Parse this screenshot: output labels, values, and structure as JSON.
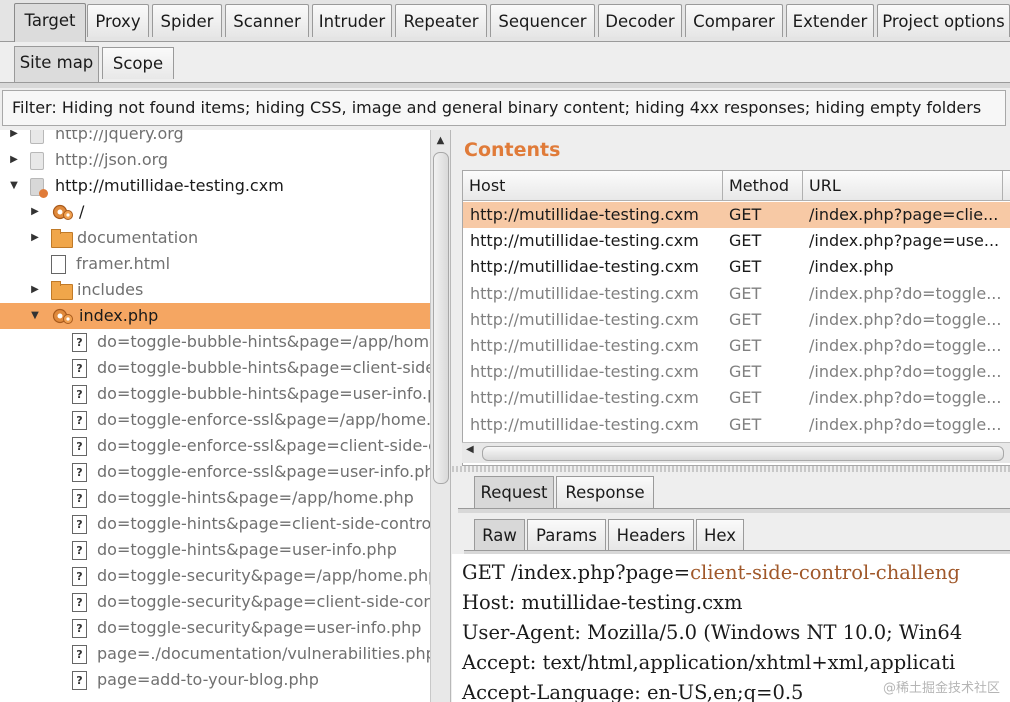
{
  "top_tabs": [
    "Target",
    "Proxy",
    "Spider",
    "Scanner",
    "Intruder",
    "Repeater",
    "Sequencer",
    "Decoder",
    "Comparer",
    "Extender",
    "Project options"
  ],
  "sub_tabs": [
    "Site map",
    "Scope"
  ],
  "filter": "Filter: Hiding not found items;  hiding CSS, image and general binary content;  hiding 4xx responses;  hiding empty folders",
  "tree": [
    {
      "label": "http://jquery.org",
      "type": "host",
      "expand": "collapsed",
      "indent": 0,
      "style": "gray"
    },
    {
      "label": "http://json.org",
      "type": "host",
      "expand": "collapsed",
      "indent": 0,
      "style": "gray"
    },
    {
      "label": "http://mutillidae-testing.cxm",
      "type": "host-active",
      "expand": "expanded",
      "indent": 0,
      "style": "dark"
    },
    {
      "label": "/",
      "type": "gear",
      "expand": "collapsed",
      "indent": 1,
      "style": "dark"
    },
    {
      "label": "documentation",
      "type": "folder",
      "expand": "collapsed",
      "indent": 1,
      "style": "gray"
    },
    {
      "label": "framer.html",
      "type": "file",
      "expand": "none",
      "indent": 1,
      "style": "gray"
    },
    {
      "label": "includes",
      "type": "folder",
      "expand": "collapsed",
      "indent": 1,
      "style": "gray"
    },
    {
      "label": "index.php",
      "type": "gear",
      "expand": "expanded",
      "indent": 1,
      "style": "dark",
      "selected": true
    },
    {
      "label": "do=toggle-bubble-hints&page=/app/home.",
      "type": "q",
      "expand": "none",
      "indent": 2,
      "style": "gray"
    },
    {
      "label": "do=toggle-bubble-hints&page=client-side-",
      "type": "q",
      "expand": "none",
      "indent": 2,
      "style": "gray"
    },
    {
      "label": "do=toggle-bubble-hints&page=user-info.pl",
      "type": "q",
      "expand": "none",
      "indent": 2,
      "style": "gray"
    },
    {
      "label": "do=toggle-enforce-ssl&page=/app/home.p",
      "type": "q",
      "expand": "none",
      "indent": 2,
      "style": "gray"
    },
    {
      "label": "do=toggle-enforce-ssl&page=client-side-co",
      "type": "q",
      "expand": "none",
      "indent": 2,
      "style": "gray"
    },
    {
      "label": "do=toggle-enforce-ssl&page=user-info.php",
      "type": "q",
      "expand": "none",
      "indent": 2,
      "style": "gray"
    },
    {
      "label": "do=toggle-hints&page=/app/home.php",
      "type": "q",
      "expand": "none",
      "indent": 2,
      "style": "gray"
    },
    {
      "label": "do=toggle-hints&page=client-side-control-",
      "type": "q",
      "expand": "none",
      "indent": 2,
      "style": "gray"
    },
    {
      "label": "do=toggle-hints&page=user-info.php",
      "type": "q",
      "expand": "none",
      "indent": 2,
      "style": "gray"
    },
    {
      "label": "do=toggle-security&page=/app/home.php",
      "type": "q",
      "expand": "none",
      "indent": 2,
      "style": "gray"
    },
    {
      "label": "do=toggle-security&page=client-side-contr",
      "type": "q",
      "expand": "none",
      "indent": 2,
      "style": "gray"
    },
    {
      "label": "do=toggle-security&page=user-info.php",
      "type": "q",
      "expand": "none",
      "indent": 2,
      "style": "gray"
    },
    {
      "label": "page=./documentation/vulnerabilities.php",
      "type": "q",
      "expand": "none",
      "indent": 2,
      "style": "gray"
    },
    {
      "label": "page=add-to-your-blog.php",
      "type": "q",
      "expand": "none",
      "indent": 2,
      "style": "gray"
    }
  ],
  "contents": {
    "title": "Contents",
    "columns": [
      "Host",
      "Method",
      "URL"
    ],
    "rows": [
      {
        "host": "http://mutillidae-testing.cxm",
        "method": "GET",
        "url": "/index.php?page=clie...",
        "selected": true,
        "dim": false
      },
      {
        "host": "http://mutillidae-testing.cxm",
        "method": "GET",
        "url": "/index.php?page=use...",
        "selected": false,
        "dim": false
      },
      {
        "host": "http://mutillidae-testing.cxm",
        "method": "GET",
        "url": "/index.php",
        "selected": false,
        "dim": false
      },
      {
        "host": "http://mutillidae-testing.cxm",
        "method": "GET",
        "url": "/index.php?do=toggle...",
        "selected": false,
        "dim": true
      },
      {
        "host": "http://mutillidae-testing.cxm",
        "method": "GET",
        "url": "/index.php?do=toggle...",
        "selected": false,
        "dim": true
      },
      {
        "host": "http://mutillidae-testing.cxm",
        "method": "GET",
        "url": "/index.php?do=toggle...",
        "selected": false,
        "dim": true
      },
      {
        "host": "http://mutillidae-testing.cxm",
        "method": "GET",
        "url": "/index.php?do=toggle...",
        "selected": false,
        "dim": true
      },
      {
        "host": "http://mutillidae-testing.cxm",
        "method": "GET",
        "url": "/index.php?do=toggle...",
        "selected": false,
        "dim": true
      },
      {
        "host": "http://mutillidae-testing.cxm",
        "method": "GET",
        "url": "/index.php?do=toggle...",
        "selected": false,
        "dim": true
      }
    ]
  },
  "message_tabs": [
    "Request",
    "Response"
  ],
  "view_tabs": [
    "Raw",
    "Params",
    "Headers",
    "Hex"
  ],
  "raw_request": {
    "line1_prefix": "GET /index.php?page=",
    "line1_param": "client-side-control-challeng",
    "lines": [
      "Host: mutillidae-testing.cxm",
      "User-Agent: Mozilla/5.0 (Windows NT 10.0; Win64",
      "Accept: text/html,application/xhtml+xml,applicati",
      "Accept-Language: en-US,en;q=0.5"
    ]
  },
  "watermark": "@稀土掘金技术社区",
  "colors": {
    "accent": "#e07b39",
    "selected_tree": "#f5a662",
    "selected_row": "#f7c9a5"
  }
}
